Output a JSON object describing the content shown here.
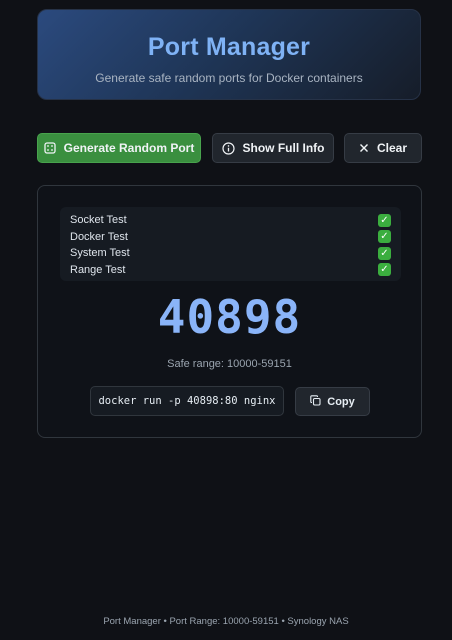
{
  "header": {
    "title": "Port Manager",
    "subtitle": "Generate safe random ports for Docker containers"
  },
  "toolbar": {
    "generate_label": "Generate Random Port",
    "info_label": "Show Full Info",
    "clear_label": "Clear"
  },
  "tests": [
    {
      "label": "Socket Test",
      "status": "passed"
    },
    {
      "label": "Docker Test",
      "status": "passed"
    },
    {
      "label": "System Test",
      "status": "passed"
    },
    {
      "label": "Range Test",
      "status": "passed"
    }
  ],
  "result": {
    "port": "40898",
    "safe_range": "Safe range: 10000-59151",
    "command": "docker run -p 40898:80 nginx",
    "copy_label": "Copy"
  },
  "footer": {
    "text": "Port Manager • Port Range: 10000-59151 • Synology NAS"
  },
  "colors": {
    "accent_blue": "#7fb2f5",
    "primary_green": "#3a8f3f",
    "check_green": "#3bae3f",
    "background": "#0f1116"
  },
  "icons": {
    "generate": "grid-dice-icon",
    "info": "info-circle-icon",
    "clear": "x-icon",
    "copy": "copy-icon",
    "check": "check-box-icon"
  }
}
